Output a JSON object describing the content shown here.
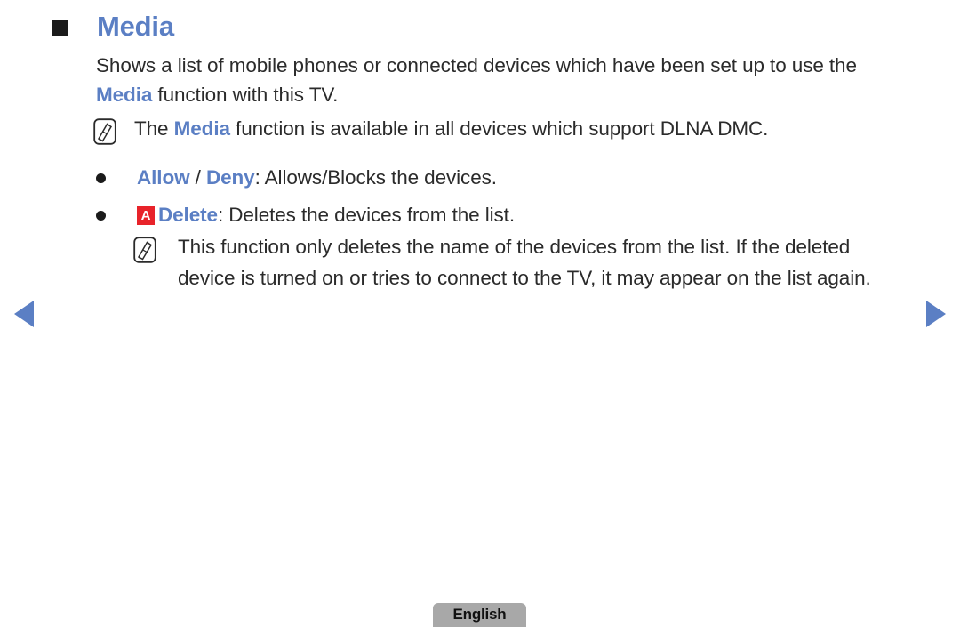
{
  "page": {
    "heading": {
      "bullet_icon": "filled-square-bullet",
      "title": "Media"
    },
    "intro_paragraph": {
      "part1": "Shows a list of mobile phones or connected devices which have been set up to use the ",
      "highlight": "Media",
      "part2": " function with this TV."
    },
    "notes": [
      {
        "icon": "note-pen-icon",
        "part1": "The ",
        "highlight": "Media",
        "part2": " function is available in all devices which support DLNA DMC."
      },
      {
        "icon": "note-pen-icon",
        "text": "This function only deletes the name of the devices from the list. If the deleted device is turned on or tries to connect to the TV, it may appear on the list again."
      }
    ],
    "bullets": [
      {
        "marker": "round-dot-bullet",
        "label_a": "Allow",
        "separator": " / ",
        "label_b": "Deny",
        "description": ": Allows/Blocks the devices."
      },
      {
        "marker": "round-dot-bullet",
        "key_badge": "A",
        "label": "Delete",
        "description": ": Deletes the devices from the list."
      }
    ],
    "navigation": {
      "prev_icon": "triangle-left-icon",
      "next_icon": "triangle-right-icon"
    },
    "footer": {
      "language_label": "English"
    },
    "colors": {
      "accent_blue": "#5b7fc4",
      "badge_red": "#e8232a",
      "text": "#2b2b2b",
      "footer_gray": "#a8a8a8"
    }
  }
}
